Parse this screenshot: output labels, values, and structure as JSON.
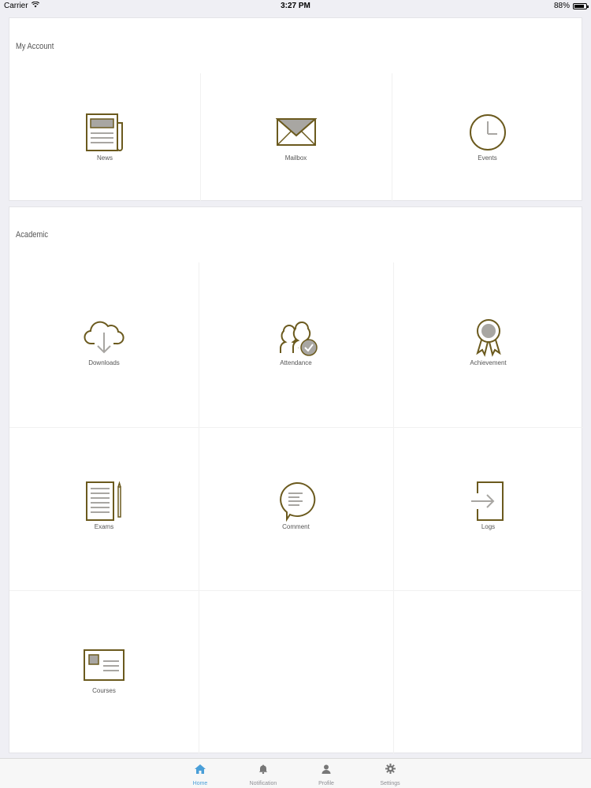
{
  "status": {
    "carrier": "Carrier",
    "time": "3:27 PM",
    "battery": "88%",
    "battery_level": 0.88
  },
  "my_account": {
    "title": "My Account",
    "tiles": [
      {
        "label": "News",
        "icon": "newspaper-icon"
      },
      {
        "label": "Mailbox",
        "icon": "envelope-icon"
      },
      {
        "label": "Events",
        "icon": "clock-icon"
      }
    ]
  },
  "academic": {
    "title": "Academic",
    "tiles": [
      {
        "label": "Downloads",
        "icon": "cloud-download-icon"
      },
      {
        "label": "Attendance",
        "icon": "users-check-icon"
      },
      {
        "label": "Achievement",
        "icon": "award-ribbon-icon"
      },
      {
        "label": "Exams",
        "icon": "document-pencil-icon"
      },
      {
        "label": "Comment",
        "icon": "speech-bubble-icon"
      },
      {
        "label": "Logs",
        "icon": "login-arrow-icon"
      },
      {
        "label": "Courses",
        "icon": "course-card-icon"
      }
    ]
  },
  "tabs": [
    {
      "label": "Home",
      "icon": "home-icon",
      "active": true
    },
    {
      "label": "Notification",
      "icon": "bell-icon",
      "active": false
    },
    {
      "label": "Profile",
      "icon": "person-icon",
      "active": false
    },
    {
      "label": "Settings",
      "icon": "gear-icon",
      "active": false
    }
  ],
  "colors": {
    "icon_stroke": "#6b5a1e",
    "icon_fill": "#a8a6a2",
    "accent": "#4a9fd8"
  }
}
